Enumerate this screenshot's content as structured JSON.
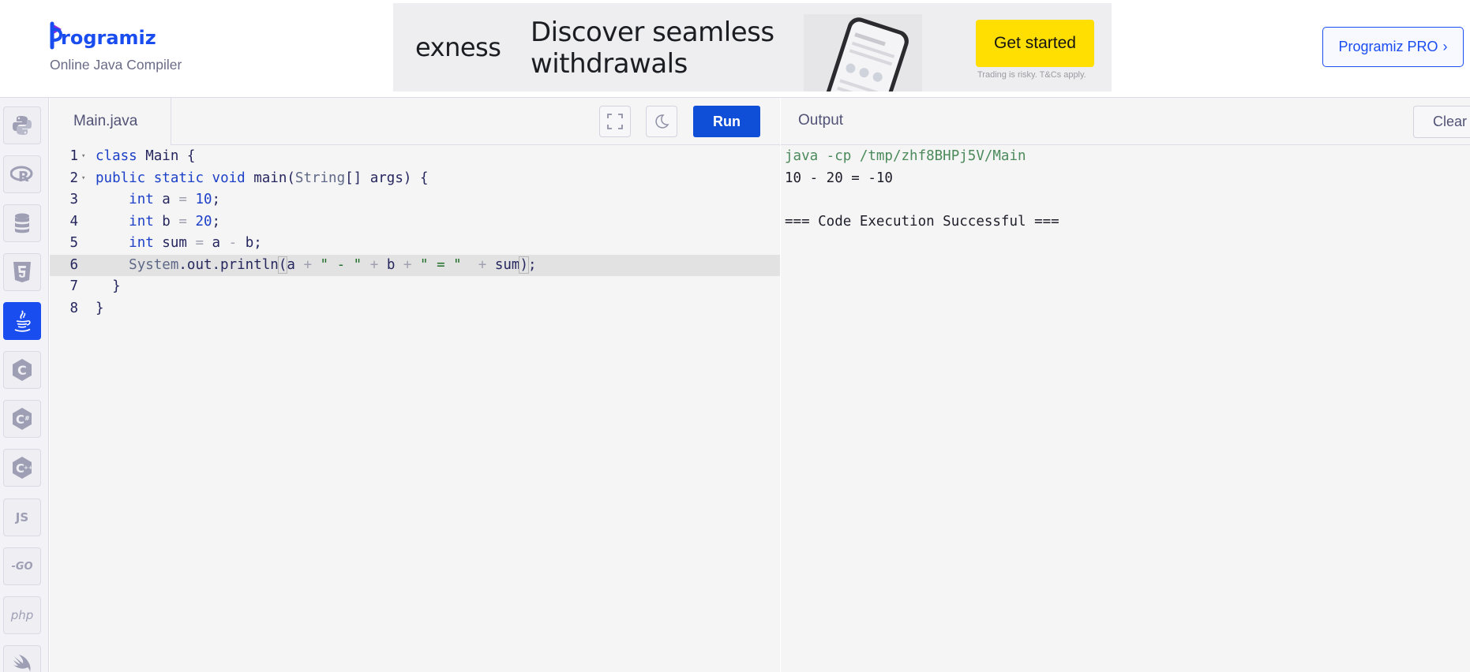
{
  "header": {
    "logo_text": "rogramiz",
    "logo_letter": "P",
    "subtitle": "Online Java Compiler",
    "pro_button": "Programiz PRO",
    "pro_chevron": "›"
  },
  "ad": {
    "brand": "exness",
    "headline": "Discover seamless withdrawals",
    "cta": "Get started",
    "disclaimer": "Trading is risky. T&Cs apply.",
    "info_icon": "info-icon",
    "close_icon": "close-icon"
  },
  "languages": [
    {
      "name": "python-icon"
    },
    {
      "name": "r-icon"
    },
    {
      "name": "sql-icon"
    },
    {
      "name": "html5-icon"
    },
    {
      "name": "java-icon",
      "active": true
    },
    {
      "name": "c-icon"
    },
    {
      "name": "csharp-icon"
    },
    {
      "name": "cpp-icon"
    },
    {
      "name": "js-icon",
      "label": "JS"
    },
    {
      "name": "go-icon",
      "label": "-GO"
    },
    {
      "name": "php-icon",
      "label": "php"
    },
    {
      "name": "swift-icon"
    }
  ],
  "editor": {
    "file_tab": "Main.java",
    "fullscreen_icon": "fullscreen-icon",
    "theme_icon": "moon-icon",
    "run_label": "Run",
    "line_numbers": [
      "1",
      "2",
      "3",
      "4",
      "5",
      "6",
      "7",
      "8"
    ],
    "highlighted_line": 6
  },
  "output": {
    "title": "Output",
    "clear_label": "Clear",
    "lines": [
      "java -cp /tmp/zhf8BHPj5V/Main",
      "10 - 20 = -10",
      "",
      "=== Code Execution Successful ==="
    ]
  },
  "colors": {
    "brand_blue": "#1a4df0",
    "run_blue": "#0f4ed6",
    "ad_yellow": "#ffde02",
    "keyword_blue": "#1d40c8",
    "string_green": "#1f6e2a"
  }
}
